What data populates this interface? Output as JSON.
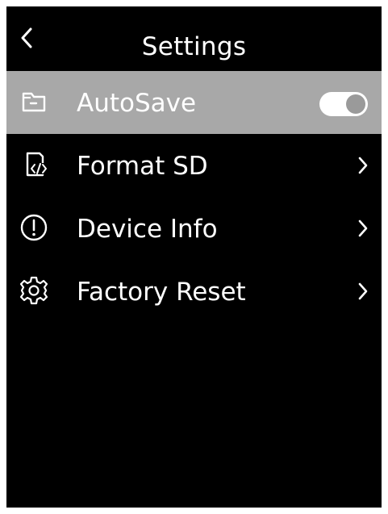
{
  "header": {
    "title": "Settings",
    "back_icon": "chevron-left-icon"
  },
  "menu": {
    "items": [
      {
        "label": "AutoSave",
        "icon": "folder-icon",
        "control": "toggle",
        "toggle_on": true,
        "selected": true
      },
      {
        "label": "Format SD",
        "icon": "sd-card-code-icon",
        "control": "chevron",
        "selected": false
      },
      {
        "label": "Device Info",
        "icon": "info-circle-icon",
        "control": "chevron",
        "selected": false
      },
      {
        "label": "Factory Reset",
        "icon": "gear-icon",
        "control": "chevron",
        "selected": false
      }
    ]
  },
  "colors": {
    "background": "#000000",
    "selected_row": "#a8a8a8",
    "text": "#ffffff",
    "toggle_track": "#ffffff",
    "toggle_knob": "#9a9a9a"
  }
}
